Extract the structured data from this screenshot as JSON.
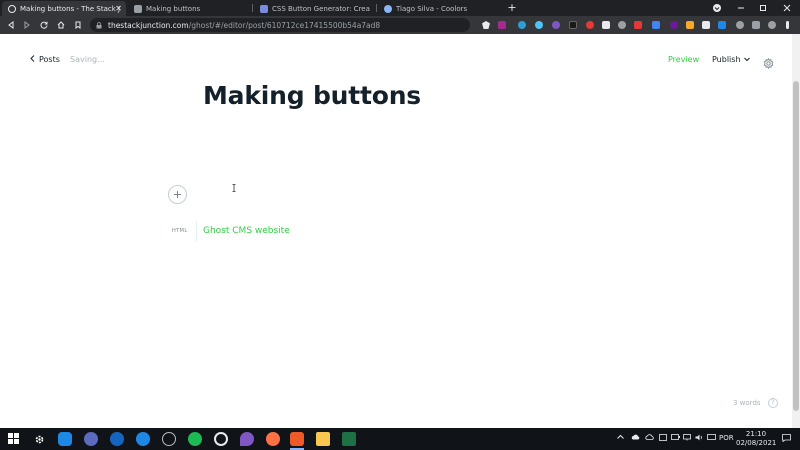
{
  "browser": {
    "tabs": [
      {
        "title": "Making buttons - The Stack Junct",
        "active": true,
        "favicon_color": "#e8eaed"
      },
      {
        "title": "Making buttons",
        "active": false,
        "favicon_color": "#9aa0a6"
      },
      {
        "title": "CSS Button Generator: Create HTML a",
        "active": false,
        "favicon_color": "#7b8cde"
      },
      {
        "title": "Tiago Silva - Coolors",
        "active": false,
        "favicon_color": "#8ab4f8"
      }
    ],
    "tab_close_glyph": "✕",
    "new_tab_glyph": "+",
    "address": {
      "domain": "thestackjunction.com",
      "path": "/ghost/#/editor/post/610712ce17415500b54a7ad8"
    }
  },
  "editor": {
    "back_label": "Posts",
    "status": "Saving...",
    "preview_label": "Preview",
    "publish_label": "Publish",
    "title": "Making buttons",
    "html_card_label": "HTML",
    "html_card_content": "Ghost CMS website",
    "word_count": "3 words",
    "help_glyph": "?"
  },
  "taskbar": {
    "language": "POR",
    "time": "21:10",
    "date": "02/08/2021"
  },
  "colors": {
    "accent_green": "#30cf43",
    "title_text": "#15212a",
    "muted_text": "#abb4be"
  }
}
